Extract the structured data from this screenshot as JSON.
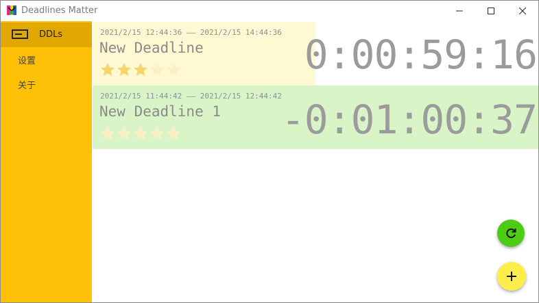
{
  "window": {
    "title": "Deadlines Matter"
  },
  "sidebar": {
    "items": [
      {
        "label": "DDLs",
        "icon": "ddl-list-icon",
        "active": true
      },
      {
        "label": "设置",
        "active": false
      },
      {
        "label": "关于",
        "active": false
      }
    ]
  },
  "deadlines": [
    {
      "time_range": "2021/2/15 12:44:36 —— 2021/2/15 14:44:36",
      "title": "New Deadline",
      "stars_filled": 3,
      "stars_total": 5,
      "countdown": "0:00:59:16",
      "progress_fraction": 0.5,
      "color": "#fff9d3"
    },
    {
      "time_range": "2021/2/15 11:44:42 —— 2021/2/15 12:44:42",
      "title": "New Deadline 1",
      "stars_filled": 0,
      "stars_total": 5,
      "countdown": "-0:01:00:37",
      "color": "#d9f5c8"
    }
  ],
  "colors": {
    "sidebar": "#ffc107",
    "sidebar_active": "#e0a800",
    "refresh_fab": "#4ccc14",
    "add_fab": "#fdee4a",
    "star_filled": "#f7d36a",
    "star_empty": "#fbf0c4"
  },
  "actions": {
    "refresh_icon": "refresh-icon",
    "add_icon": "plus-icon"
  }
}
